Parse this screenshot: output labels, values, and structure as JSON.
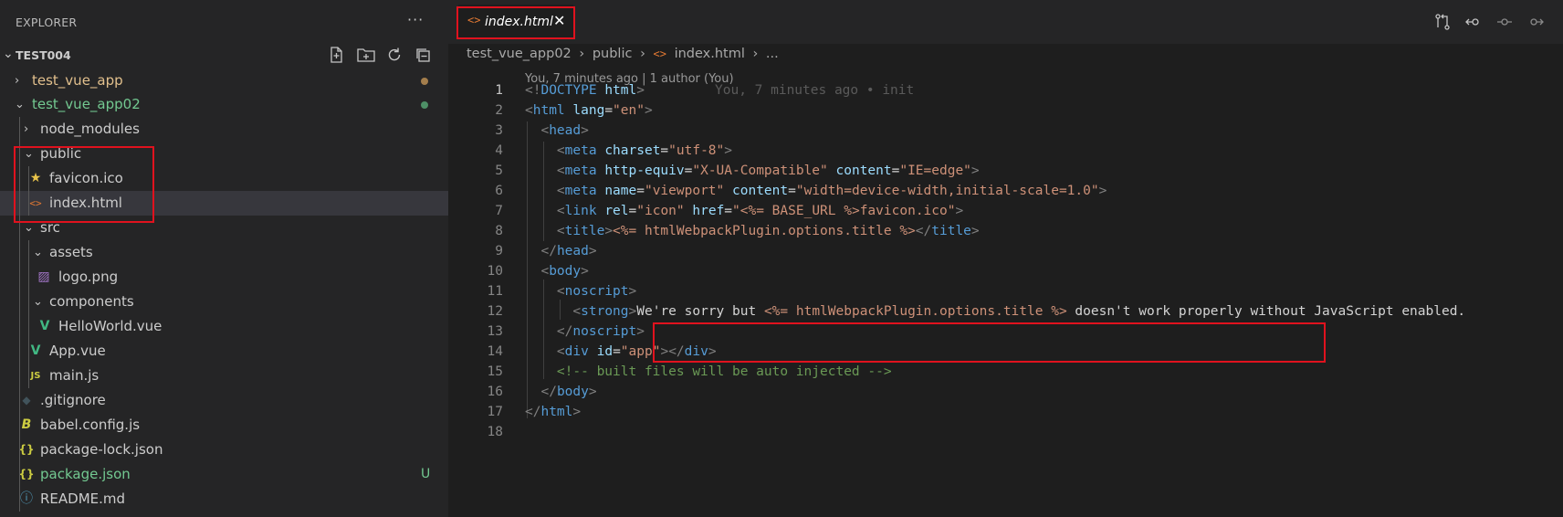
{
  "sidebar": {
    "title": "EXPLORER",
    "more": "···",
    "root": {
      "label": "TEST004"
    },
    "root_actions": [
      "new-file-icon",
      "new-folder-icon",
      "refresh-icon",
      "collapse-all-icon"
    ],
    "items": [
      {
        "label": "test_vue_app",
        "color": "#e2c08d",
        "icon": "",
        "chevron": "›",
        "status": "dot"
      },
      {
        "label": "test_vue_app02",
        "color": "#73c991",
        "icon": "",
        "chevron": "⌄",
        "status": "dot"
      },
      {
        "label": "node_modules",
        "color": "#cccccc",
        "icon": "",
        "chevron": "›"
      },
      {
        "label": "public",
        "color": "#cccccc",
        "icon": "",
        "chevron": "⌄"
      },
      {
        "label": "favicon.ico",
        "color": "#cccccc",
        "icon": "★"
      },
      {
        "label": "index.html",
        "color": "#cccccc",
        "icon": "<>"
      },
      {
        "label": "src",
        "color": "#cccccc",
        "icon": "",
        "chevron": "⌄"
      },
      {
        "label": "assets",
        "color": "#cccccc",
        "icon": "",
        "chevron": "⌄"
      },
      {
        "label": "logo.png",
        "color": "#cccccc",
        "icon": "▨"
      },
      {
        "label": "components",
        "color": "#cccccc",
        "icon": "",
        "chevron": "⌄"
      },
      {
        "label": "HelloWorld.vue",
        "color": "#cccccc",
        "icon": "V"
      },
      {
        "label": "App.vue",
        "color": "#cccccc",
        "icon": "V"
      },
      {
        "label": "main.js",
        "color": "#cccccc",
        "icon": "JS"
      },
      {
        "label": ".gitignore",
        "color": "#cccccc",
        "icon": "◆"
      },
      {
        "label": "babel.config.js",
        "color": "#cccccc",
        "icon": "B"
      },
      {
        "label": "package-lock.json",
        "color": "#cccccc",
        "icon": "{}"
      },
      {
        "label": "package.json",
        "color": "#73c991",
        "icon": "{}",
        "badge": "U"
      },
      {
        "label": "README.md",
        "color": "#cccccc",
        "icon": "ⓘ"
      }
    ]
  },
  "editor": {
    "tab": {
      "icon": "<>",
      "label": "index.html",
      "close": "✕"
    },
    "breadcrumb": [
      "test_vue_app02",
      "›",
      "public",
      "›",
      "<>",
      "index.html",
      "›",
      "..."
    ],
    "codelens": "You, 7 minutes ago | 1 author (You)",
    "blame": "You, 7 minutes ago • init",
    "line_numbers": [
      "1",
      "2",
      "3",
      "4",
      "5",
      "6",
      "7",
      "8",
      "9",
      "10",
      "11",
      "12",
      "13",
      "14",
      "15",
      "16",
      "17",
      "18"
    ],
    "lines": [
      "<!DOCTYPE html>",
      "<html lang=\"en\">",
      "  <head>",
      "    <meta charset=\"utf-8\">",
      "    <meta http-equiv=\"X-UA-Compatible\" content=\"IE=edge\">",
      "    <meta name=\"viewport\" content=\"width=device-width,initial-scale=1.0\">",
      "    <link rel=\"icon\" href=\"<%= BASE_URL %>favicon.ico\">",
      "    <title><%= htmlWebpackPlugin.options.title %></title>",
      "  </head>",
      "  <body>",
      "    <noscript>",
      "      <strong>We're sorry but <%= htmlWebpackPlugin.options.title %> doesn't work properly without JavaScript enabled.",
      "    </noscript>",
      "    <div id=\"app\"></div>",
      "    <!-- built files will be auto injected -->",
      "  </body>",
      "</html>",
      ""
    ]
  },
  "colors": {
    "accent_red": "#e0121e",
    "git_untracked": "#73c991",
    "git_modified": "#e2c08d"
  }
}
